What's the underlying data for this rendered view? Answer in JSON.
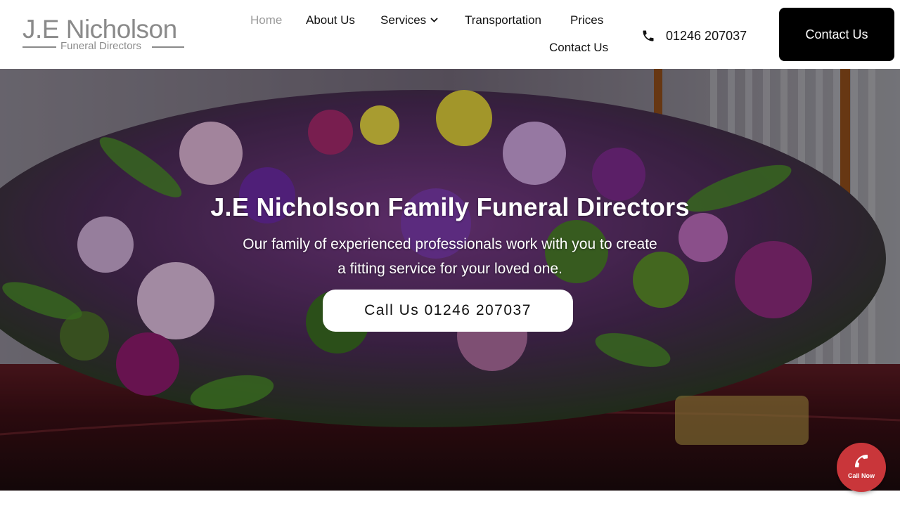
{
  "logo": {
    "main": "J.E Nicholson",
    "sub": "Funeral Directors"
  },
  "nav": {
    "items": [
      {
        "label": "Home",
        "active": true
      },
      {
        "label": "About Us"
      },
      {
        "label": "Services",
        "has_dropdown": true
      },
      {
        "label": "Transportation"
      },
      {
        "label": "Prices"
      },
      {
        "label": "Contact Us"
      }
    ]
  },
  "header": {
    "phone": "01246 207037",
    "contact_button": "Contact Us"
  },
  "hero": {
    "title": "J.E Nicholson Family Funeral Directors",
    "subtitle": "Our family of experienced professionals work with you to create a fitting service for your loved one.",
    "cta": "Call Us 01246 207037"
  },
  "floating": {
    "call_label": "Call Now"
  },
  "colors": {
    "call_button": "#c9363a",
    "contact_button_bg": "#000000",
    "nav_active": "#9a9a9a",
    "logo_grey": "#8a8a8a"
  },
  "icons": {
    "phone": "phone-icon",
    "dropdown": "chevron-down-icon"
  }
}
